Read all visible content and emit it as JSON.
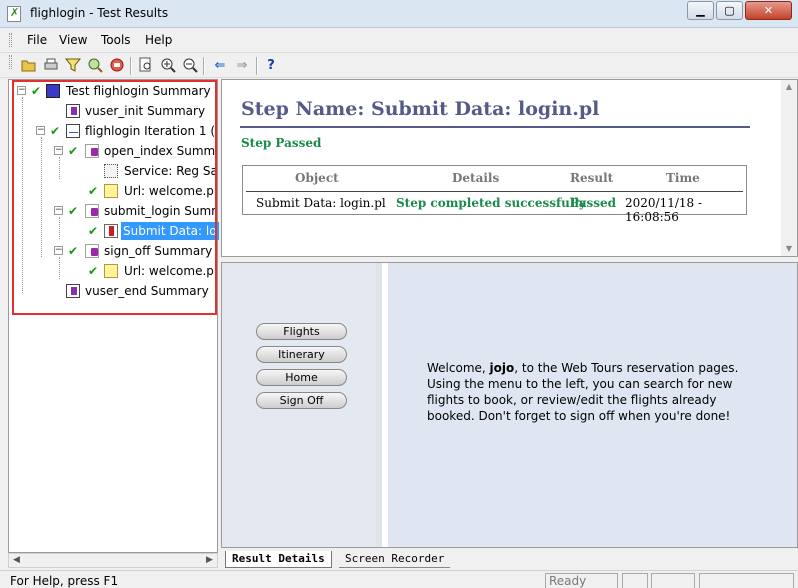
{
  "window": {
    "title": "flighlogin - Test Results",
    "min_glyph": "▁",
    "max_glyph": "▢",
    "close_glyph": "✕"
  },
  "menu": {
    "file": "File",
    "view": "View",
    "tools": "Tools",
    "help": "Help"
  },
  "toolbar": {
    "icons": [
      "open-icon",
      "print-icon",
      "filter-icon",
      "find-icon",
      "bookmark-icon",
      "print-preview-icon",
      "zoom-in-icon",
      "zoom-out-icon",
      "back-arrow-icon",
      "forward-arrow-icon",
      "help-icon"
    ],
    "help_glyph": "?",
    "back_glyph": "⇐",
    "forward_glyph": "⇒"
  },
  "tree": {
    "root": "Test flighlogin Summary",
    "vuser_init": "vuser_init Summary",
    "iteration": "flighlogin Iteration 1 (",
    "open_index": "open_index Summ",
    "service": "Service: Reg Sa",
    "url1": "Url: welcome.p",
    "submit_login": "submit_login Sumr",
    "submit_data": "Submit Data: lo",
    "sign_off": "sign_off Summary",
    "url2": "Url: welcome.p",
    "vuser_end": "vuser_end Summary",
    "expanded_glyph": "−",
    "check_glyph": "✔"
  },
  "step": {
    "title": "Step Name: Submit Data: login.pl",
    "status": "Step Passed",
    "columns": {
      "object": "Object",
      "details": "Details",
      "result": "Result",
      "time": "Time"
    },
    "row": {
      "object": "Submit Data: login.pl",
      "details": "Step completed successfully",
      "result": "Passed",
      "time": "2020/11/18 - 16:08:56"
    }
  },
  "webpage": {
    "nav": {
      "flights": "Flights",
      "itinerary": "Itinerary",
      "home": "Home",
      "sign_off": "Sign Off"
    },
    "welcome_pre": "Welcome, ",
    "user": "jojo",
    "welcome_post": ", to the Web Tours reservation pages. Using the menu to the left, you can search for new flights to book, or review/edit the flights already booked. Don't forget to sign off when you're done!"
  },
  "tabs": {
    "result_details": "Result Details",
    "screen_recorder": "Screen Recorder"
  },
  "status": {
    "help_text": "For Help, press F1",
    "ready": "Ready"
  },
  "colors": {
    "highlight_border": "#e03030",
    "passed_green": "#1a8a4a",
    "title_blue": "#555a8a",
    "selection": "#3399ff"
  }
}
